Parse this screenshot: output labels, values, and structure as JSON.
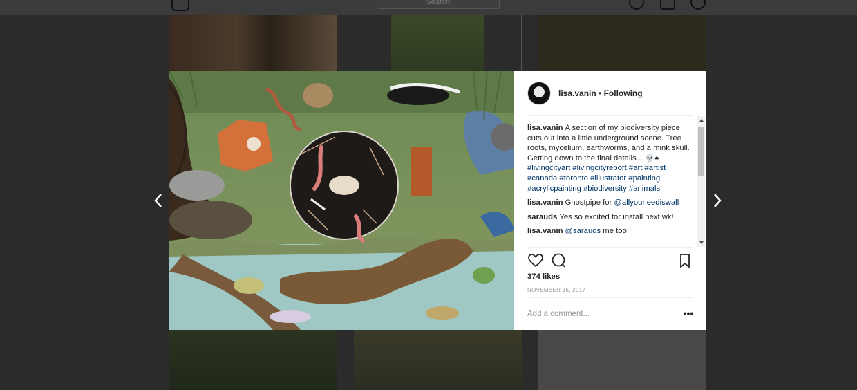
{
  "topbar": {
    "search_placeholder": "Search"
  },
  "post": {
    "username": "lisa.vanin",
    "separator": "•",
    "follow_status": "Following",
    "comments": [
      {
        "user": "lisa.vanin",
        "text": "A section of my biodiversity piece cuts out into a little underground scene. Tree roots, mycelium, earthworms, and a mink skull. Getting down to the final details... 💀♠ ",
        "tags": "#livingcityart #livingcityreport #art #artist #canada #toronto #illustrator #painting #acrylicpainting #biodiversity #animals"
      },
      {
        "user": "lisa.vanin",
        "text": "Ghostpipe for ",
        "tags": "@allyouneediswall"
      },
      {
        "user": "sarauds",
        "text": "Yes so excited for install next wk!",
        "tags": ""
      },
      {
        "user": "lisa.vanin",
        "text": " me too!!",
        "tags": "@sarauds"
      }
    ],
    "likes": "374 likes",
    "date": "NOVEMBER 16, 2017",
    "comment_placeholder": "Add a comment...",
    "more_label": "•••"
  },
  "colors": {
    "link": "#003569",
    "overlay": "#2b2b2b",
    "text": "#262626"
  }
}
